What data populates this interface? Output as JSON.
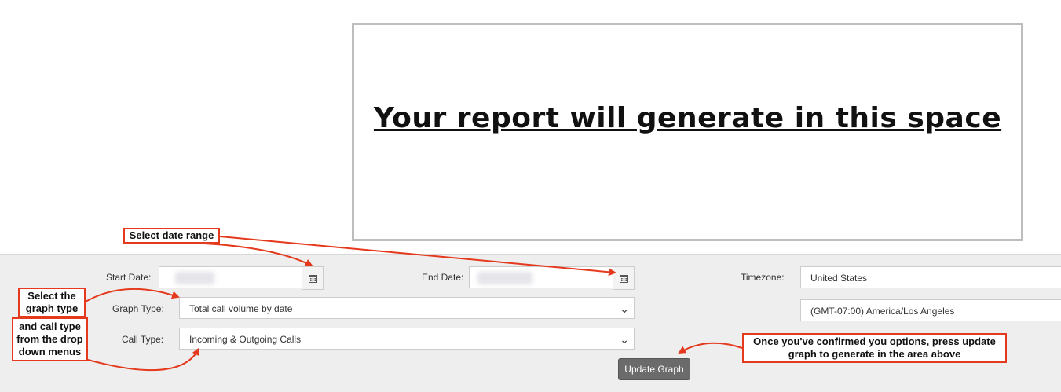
{
  "report": {
    "placeholder": "Your report will generate in this space"
  },
  "form": {
    "start_date_label": "Start Date:",
    "end_date_label": "End Date:",
    "timezone_label": "Timezone:",
    "graph_type_label": "Graph Type:",
    "call_type_label": "Call Type:",
    "graph_type_value": "Total call volume by date",
    "call_type_value": "Incoming & Outgoing Calls",
    "timezone_country": "United States",
    "timezone_zone": "(GMT-07:00) America/Los Angeles",
    "update_button": "Update Graph"
  },
  "callouts": {
    "date_range": "Select date range",
    "graph_type": "Select the graph type",
    "call_type": "and call type from the drop down menus",
    "update": "Once you've confirmed you options, press update graph to generate in the area above"
  },
  "colors": {
    "callout": "#e5391d",
    "panel": "#eeeeee",
    "button": "#6b6b6b"
  }
}
